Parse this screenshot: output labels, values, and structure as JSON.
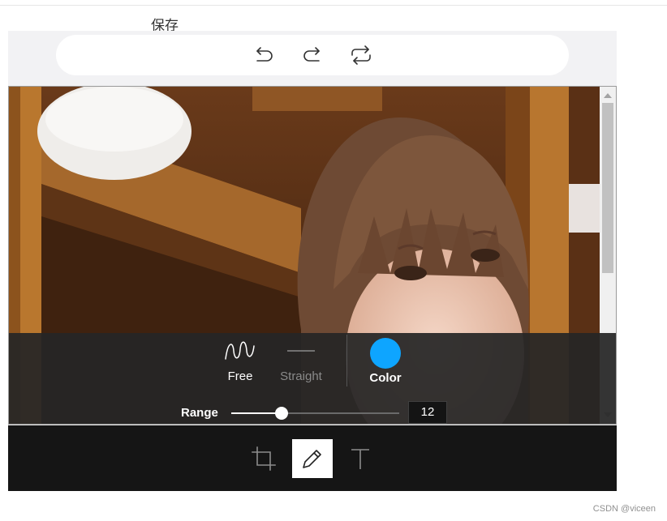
{
  "page": {
    "save_label": "保存",
    "watermark": "CSDN @viceen"
  },
  "history": {
    "undo_icon": "undo-icon",
    "redo_icon": "redo-icon",
    "reset_icon": "reset-icon"
  },
  "draw_panel": {
    "free_label": "Free",
    "straight_label": "Straight",
    "color_label": "Color",
    "selected_color": "#0ea5ff",
    "selected_mode": "Free",
    "range_label": "Range",
    "range_value": "12",
    "range_fraction": 0.3
  },
  "toolbar": {
    "tools": [
      "crop-icon",
      "pencil-icon",
      "text-icon"
    ],
    "active_tool": "pencil-icon"
  },
  "colors": {
    "accent": "#0ea5ff",
    "panel_bg": "#262626",
    "toolbar_bg": "#151515"
  }
}
